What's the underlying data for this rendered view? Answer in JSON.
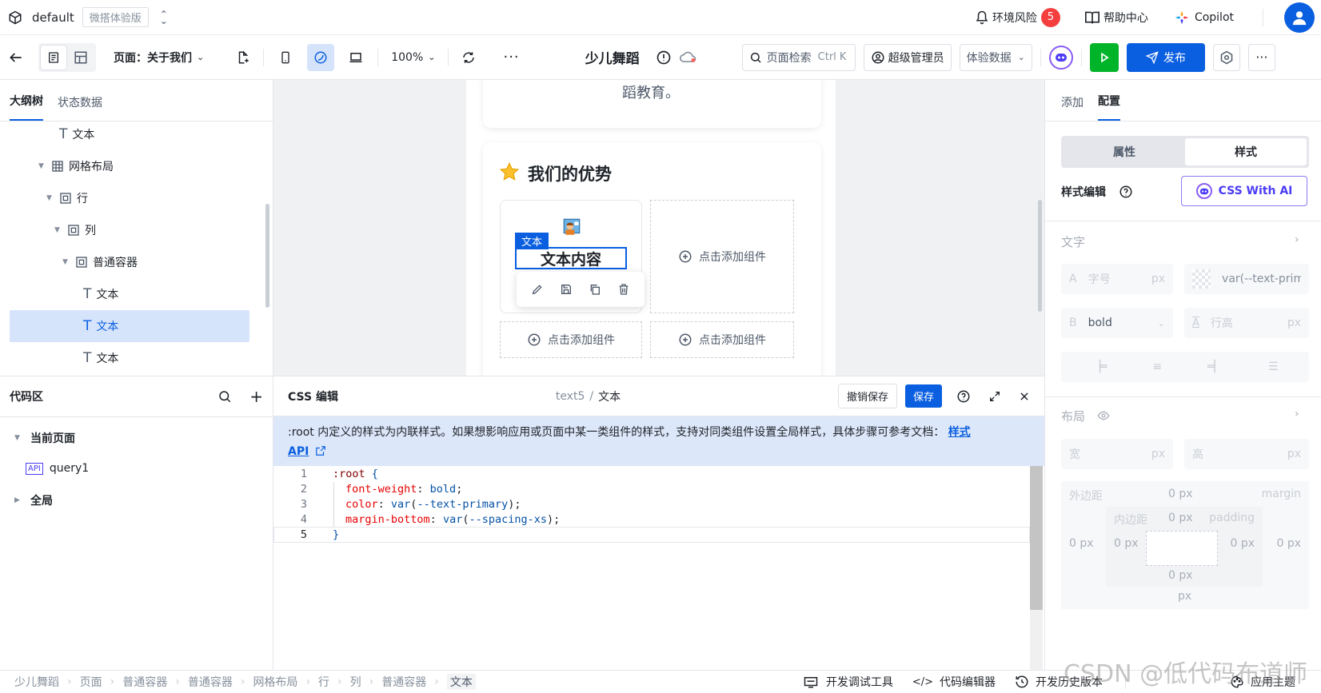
{
  "topbar": {
    "app_name": "default",
    "edition_badge": "微搭体验版",
    "env_risk_label": "环境风险",
    "env_risk_count": "5",
    "help_label": "帮助中心",
    "copilot_label": "Copilot"
  },
  "toolbar": {
    "page_selector": "页面：关于我们",
    "zoom": "100%",
    "app_title": "少儿舞蹈",
    "search_placeholder": "页面检索",
    "search_shortcut": "Ctrl K",
    "role": "超级管理员",
    "data_mode": "体验数据",
    "publish_label": "发布"
  },
  "left_panel": {
    "tabs": [
      {
        "label": "大纲树"
      },
      {
        "label": "状态数据"
      }
    ],
    "tree": [
      {
        "label": "文本"
      },
      {
        "label": "网格布局"
      },
      {
        "label": "行"
      },
      {
        "label": "列"
      },
      {
        "label": "普通容器"
      },
      {
        "label": "文本"
      },
      {
        "label": "文本"
      },
      {
        "label": "文本"
      }
    ]
  },
  "code_panel": {
    "title": "代码区",
    "groups": [
      {
        "label": "当前页面"
      },
      {
        "label": "全局"
      }
    ],
    "items": [
      {
        "label": "query1",
        "badge": "API"
      }
    ]
  },
  "canvas": {
    "top_card_text": "蹈教育。",
    "section_title": "我们的优势",
    "selected_tag": "文本",
    "selected_text": "文本内容",
    "add_component_label": "点击添加组件"
  },
  "css_editor": {
    "title": "CSS 编辑",
    "path_id": "text5",
    "path_name": "文本",
    "revert_label": "撤销保存",
    "save_label": "保存",
    "notice_text": ":root 内定义的样式为内联样式。如果想影响应用或页面中某一类组件的样式，支持对同类组件设置全局样式，具体步骤可参考文档：",
    "notice_link_1": "样式",
    "notice_link_2": "API",
    "line_numbers": [
      "1",
      "2",
      "3",
      "4",
      "5"
    ],
    "code": {
      "l1_sel": ":root",
      "l1_brace": " {",
      "l2_prop": "font-weight",
      "l2_val": "bold",
      "l3_prop": "color",
      "l3_fn": "var",
      "l3_arg": "--text-primary",
      "l4_prop": "margin-bottom",
      "l4_fn": "var",
      "l4_arg": "--spacing-xs",
      "l5": "}"
    }
  },
  "right_panel": {
    "tabs": [
      {
        "label": "添加"
      },
      {
        "label": "配置"
      }
    ],
    "subtabs": [
      {
        "label": "属性"
      },
      {
        "label": "样式"
      }
    ],
    "style_edit_label": "样式编辑",
    "css_ai_label": "CSS With AI",
    "text_section": "文字",
    "font_size_prefix": "A",
    "font_size_placeholder": "字号",
    "unit_px": "px",
    "color_value": "var(--text-prim",
    "weight_prefix": "B",
    "weight_value": "bold",
    "line_height_placeholder": "行高",
    "layout_section": "布局",
    "width_label": "宽",
    "height_label": "高",
    "margin_label": "外边距",
    "margin_en": "margin",
    "padding_label": "内边距",
    "padding_en": "padding",
    "zero_px": "0 px",
    "px_only": "px"
  },
  "footer": {
    "breadcrumbs": [
      "少儿舞蹈",
      "页面",
      "普通容器",
      "普通容器",
      "网格布局",
      "行",
      "列",
      "普通容器",
      "文本"
    ],
    "dev_tools": "开发调试工具",
    "code_editor": "代码编辑器",
    "history": "开发历史版本",
    "theme": "应用主题"
  },
  "watermark": "CSDN @低代码布道师",
  "colors": {
    "primary": "#0a5fe0",
    "green": "#1aad19",
    "danger": "#f53f3f",
    "accent_purple": "#4b3cf5"
  }
}
